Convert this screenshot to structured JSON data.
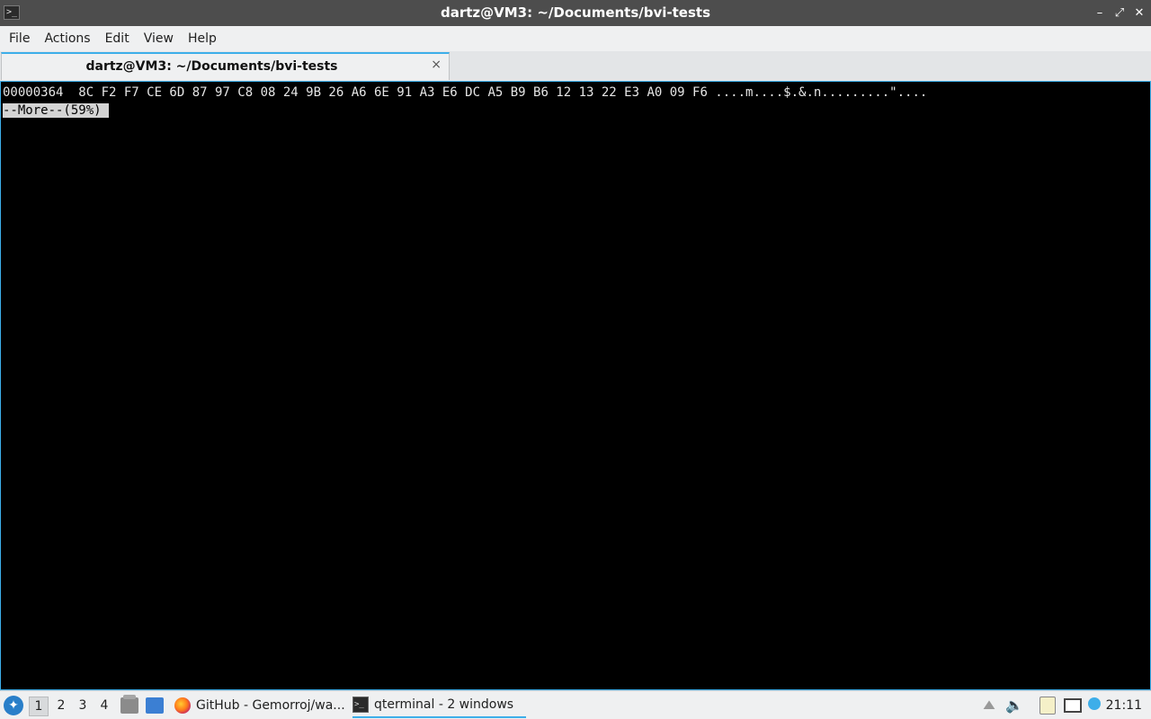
{
  "window": {
    "title": "dartz@VM3: ~/Documents/bvi-tests",
    "controls": {
      "minimize": "–",
      "restore": "⤢",
      "close": "✕"
    }
  },
  "menu": [
    "File",
    "Actions",
    "Edit",
    "View",
    "Help"
  ],
  "tabs": [
    {
      "label": "dartz@VM3: ~/Documents/bvi-tests",
      "close": "×"
    }
  ],
  "terminal": {
    "lines": [
      "00000364  8C F2 F7 CE 6D 87 97 C8 08 24 9B 26 A6 6E 91 A3 E6 DC A5 B9 B6 12 13 22 E3 A0 09 F6 ....m....$.&.n.........\"...."
    ],
    "more_prompt": "--More--(59%)",
    "cursor": " "
  },
  "taskbar": {
    "start_icon": "start-menu-icon",
    "workspaces": [
      "1",
      "2",
      "3",
      "4"
    ],
    "active_workspace": "1",
    "quicklaunch": [
      "file-manager-icon",
      "show-desktop-icon"
    ],
    "tasks": [
      {
        "label": "GitHub - Gemorroj/wa...",
        "icon": "firefox-icon"
      },
      {
        "label": "qterminal - 2 windows",
        "icon": "terminal-icon"
      }
    ],
    "tray_icons": [
      "tray-up-arrow-icon",
      "volume-icon",
      "clipboard-icon",
      "network-icon",
      "updates-icon"
    ],
    "clock": "21:11"
  },
  "colors": {
    "accent": "#3daee9",
    "titlebar": "#4d4d4d",
    "terminal_bg": "#000000"
  }
}
